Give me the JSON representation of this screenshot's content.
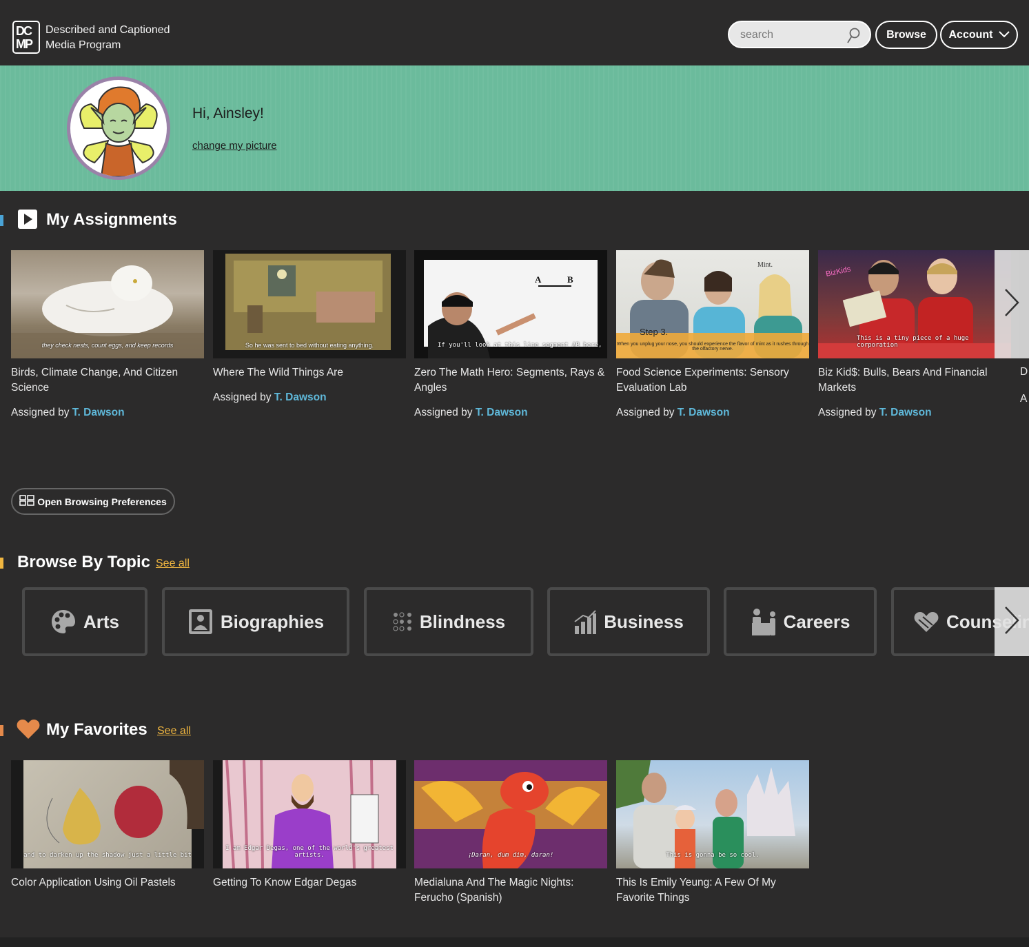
{
  "header": {
    "brand_line1": "Described and Captioned",
    "brand_line2": "Media Program",
    "logo_text_1": "DC",
    "logo_text_2": "MP",
    "search_placeholder": "search",
    "browse_label": "Browse",
    "account_label": "Account"
  },
  "banner": {
    "greeting": "Hi, Ainsley!",
    "change_picture": "change my picture"
  },
  "assignments": {
    "title": "My Assignments",
    "assigned_by_prefix": "Assigned by",
    "items": [
      {
        "title": "Birds, Climate Change, And Citizen Science",
        "teacher": "T. Dawson",
        "caption": "they check nests, count eggs, and keep records"
      },
      {
        "title": "Where The Wild Things Are",
        "teacher": "T. Dawson",
        "caption": "So he was sent to bed without eating anything."
      },
      {
        "title": "Zero The Math Hero: Segments, Rays & Angles",
        "teacher": "T. Dawson",
        "caption": "If you'll look at this line segment AB here,"
      },
      {
        "title": "Food Science Experiments: Sensory Evaluation Lab",
        "teacher": "T. Dawson",
        "caption": "When you unplug your nose, you should experience the flavor of mint as it rushes through the olfactory nerve."
      },
      {
        "title": "Biz Kid$: Bulls, Bears And Financial Markets",
        "teacher": "T. Dawson",
        "caption": "This is a tiny piece of a huge corporation"
      }
    ],
    "partial_title_char": "D",
    "partial_assigned_char": "A"
  },
  "preferences": {
    "label": "Open Browsing Preferences"
  },
  "topics": {
    "title": "Browse By Topic",
    "see_all": "See all",
    "items": [
      {
        "label": "Arts",
        "icon": "palette-icon"
      },
      {
        "label": "Biographies",
        "icon": "portrait-icon"
      },
      {
        "label": "Blindness",
        "icon": "braille-icon"
      },
      {
        "label": "Business",
        "icon": "growth-chart-icon"
      },
      {
        "label": "Careers",
        "icon": "worker-icon"
      },
      {
        "label": "Counseling",
        "icon": "hands-heart-icon"
      }
    ]
  },
  "favorites": {
    "title": "My Favorites",
    "see_all": "See all",
    "items": [
      {
        "title": "Color Application Using Oil Pastels",
        "caption": "and to darken up the shadow just a little bit"
      },
      {
        "title": "Getting To Know Edgar Degas",
        "caption": "I am Edgar Degas, one of the world's greatest artists."
      },
      {
        "title": "Medialuna And The Magic Nights: Ferucho (Spanish)",
        "caption": "¡Daran, dum dim, daran!"
      },
      {
        "title": "This Is Emily Yeung: A Few Of My Favorite Things",
        "caption": "This is gonna be so cool."
      }
    ]
  },
  "colors": {
    "banner": "#6bbb9c",
    "teacher_link": "#5fb8d9",
    "see_all": "#f0b640",
    "assignments_mark": "#4aa3d6",
    "topics_mark": "#f0b640",
    "favorites_mark": "#e58a4b"
  }
}
